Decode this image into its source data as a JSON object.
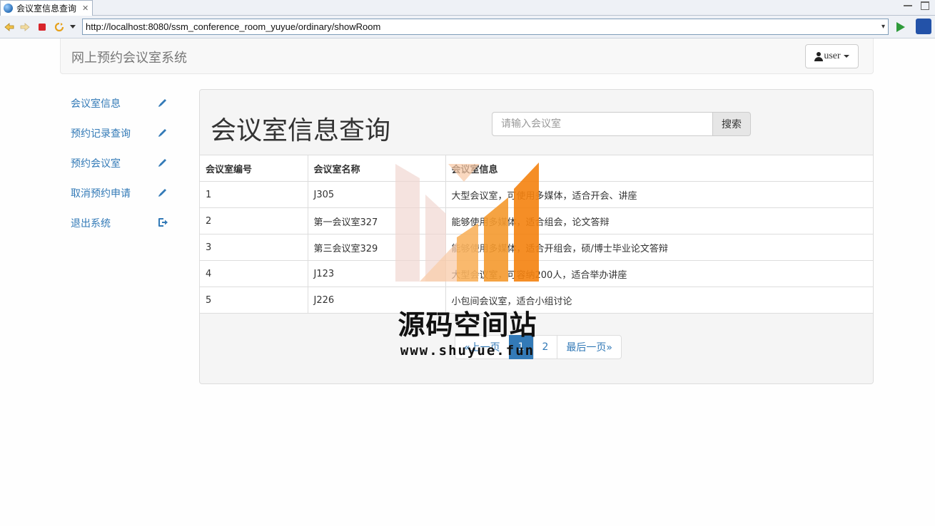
{
  "browser": {
    "tab_title": "会议室信息查询",
    "url": "http://localhost:8080/ssm_conference_room_yuyue/ordinary/showRoom"
  },
  "header": {
    "brand": "网上预约会议室系统",
    "user_label": "user"
  },
  "sidebar": {
    "items": [
      {
        "label": "会议室信息",
        "icon": "pencil-icon"
      },
      {
        "label": "预约记录查询",
        "icon": "pencil-icon"
      },
      {
        "label": "预约会议室",
        "icon": "pencil-icon"
      },
      {
        "label": "取消预约申请",
        "icon": "pencil-icon"
      },
      {
        "label": "退出系统",
        "icon": "logout-icon"
      }
    ]
  },
  "main": {
    "title": "会议室信息查询",
    "search": {
      "placeholder": "请输入会议室",
      "button": "搜索"
    },
    "table": {
      "headers": [
        "会议室编号",
        "会议室名称",
        "会议室信息"
      ],
      "rows": [
        [
          "1",
          "J305",
          "大型会议室，可使用多媒体，适合开会、讲座"
        ],
        [
          "2",
          "第一会议室327",
          "能够使用多媒体，适合组会，论文答辩"
        ],
        [
          "3",
          "第三会议室329",
          "能够使用多媒体，适合开组会，硕/博士毕业论文答辩"
        ],
        [
          "4",
          "J123",
          "大型会议室，可容纳200人，适合举办讲座"
        ],
        [
          "5",
          "J226",
          "小包间会议室，适合小组讨论"
        ]
      ]
    },
    "pagination": {
      "prev": "«上一页",
      "pages": [
        "1",
        "2"
      ],
      "active_page": "1",
      "last": "最后一页»"
    }
  },
  "watermark": {
    "text": "源码空间站",
    "url": "www.shuyue.fun"
  },
  "colors": {
    "link": "#337ab7",
    "watermark_orange": "#f5820f",
    "watermark_pink": "#f0d5d0"
  }
}
